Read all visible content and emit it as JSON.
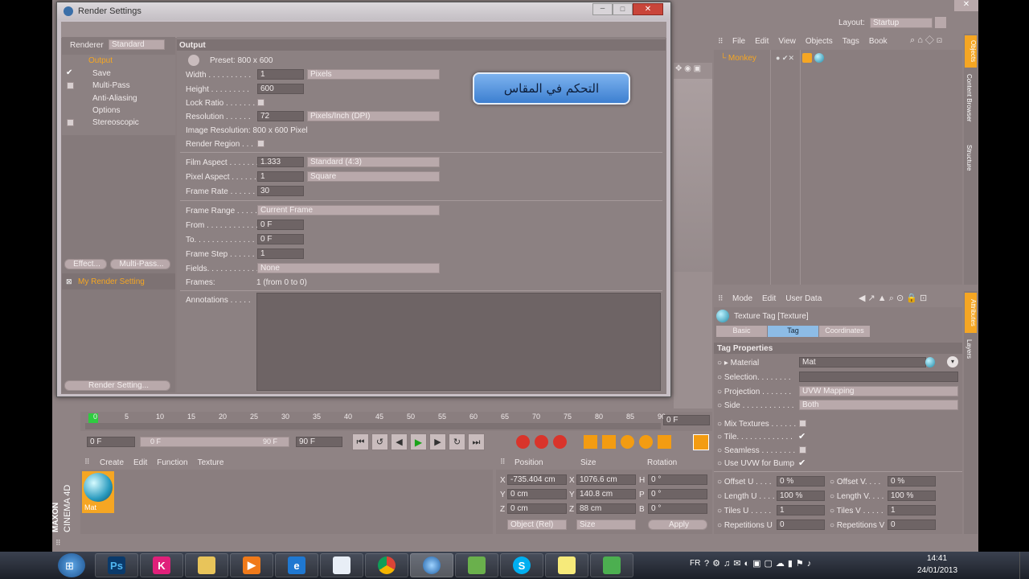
{
  "window": {
    "title": "Render Settings"
  },
  "renderer": {
    "label": "Renderer",
    "value": "Standard"
  },
  "nav": {
    "items": [
      {
        "label": "Output",
        "active": true,
        "checked": false
      },
      {
        "label": "Save",
        "active": false,
        "checked": true
      },
      {
        "label": "Multi-Pass",
        "active": false,
        "checked": false
      },
      {
        "label": "Anti-Aliasing",
        "active": false,
        "checked": false
      },
      {
        "label": "Options",
        "active": false,
        "checked": false
      },
      {
        "label": "Stereoscopic",
        "active": false,
        "checked": false
      }
    ],
    "effect_button": "Effect...",
    "multipass_button": "Multi-Pass...",
    "setting_item": "My Render Setting",
    "render_setting_button": "Render Setting..."
  },
  "output": {
    "header": "Output",
    "preset": "Preset: 800 x 600",
    "width": {
      "label": "Width . . . . . . . . . .",
      "value": "1",
      "unit": "Pixels"
    },
    "height": {
      "label": "Height . . . . . . . . .",
      "value": "600"
    },
    "lock_ratio": {
      "label": "Lock Ratio . . . . . . ."
    },
    "resolution": {
      "label": "Resolution . . . . . .",
      "value": "72",
      "unit": "Pixels/Inch (DPI)"
    },
    "image_resolution": "Image Resolution: 800 x 600 Pixel",
    "render_region": {
      "label": "Render Region . . ."
    },
    "film_aspect": {
      "label": "Film Aspect . . . . . . .",
      "value": "1.333",
      "preset": "Standard (4:3)"
    },
    "pixel_aspect": {
      "label": "Pixel Aspect . . . . . .",
      "value": "1",
      "preset": "Square"
    },
    "frame_rate": {
      "label": "Frame Rate . . . . . .",
      "value": "30"
    },
    "frame_range": {
      "label": "Frame Range . . . . .",
      "value": "Current Frame"
    },
    "from": {
      "label": "From . . . . . . . . . . . .",
      "value": "0 F"
    },
    "to": {
      "label": "To. . . . . . . . . . . . . . .",
      "value": "0 F"
    },
    "frame_step": {
      "label": "Frame Step . . . . . .",
      "value": "1"
    },
    "fields": {
      "label": "Fields. . . . . . . . . . . .",
      "value": "None"
    },
    "frames": {
      "label": "Frames:",
      "value": "1 (from 0 to 0)"
    },
    "annotations": {
      "label": "Annotations . . . . ."
    }
  },
  "caption": "التحكم في المقاس",
  "layout": {
    "label": "Layout:",
    "value": "Startup"
  },
  "object_manager": {
    "menu": [
      "File",
      "Edit",
      "View",
      "Objects",
      "Tags",
      "Book"
    ],
    "objects": [
      {
        "name": "Monkey"
      }
    ]
  },
  "side_tabs": [
    "Objects",
    "Content Browser",
    "Structure"
  ],
  "side_tabs_attr": [
    "Attributes",
    "Layers"
  ],
  "attributes": {
    "menu": [
      "Mode",
      "Edit",
      "User Data"
    ],
    "title": "Texture Tag [Texture]",
    "tabs": [
      "Basic",
      "Tag",
      "Coordinates"
    ],
    "section": "Tag Properties",
    "material": {
      "label": "Material",
      "value": "Mat"
    },
    "selection": {
      "label": "Selection. . . . . . . ."
    },
    "projection": {
      "label": "Projection . . . . . . .",
      "value": "UVW Mapping"
    },
    "side": {
      "label": "Side . . . . . . . . . . . .",
      "value": "Both"
    },
    "mix_textures": {
      "label": "Mix Textures . . . . . ."
    },
    "tile": {
      "label": "Tile. . . . . . . . . . . . ."
    },
    "seamless": {
      "label": "Seamless . . . . . . . ."
    },
    "use_uvw_bump": {
      "label": "Use UVW for Bump"
    },
    "offset_u": {
      "label": "Offset U . . . .",
      "value": "0 %"
    },
    "offset_v": {
      "label": "Offset V. . . .",
      "value": "0 %"
    },
    "length_u": {
      "label": "Length U . . . .",
      "value": "100 %"
    },
    "length_v": {
      "label": "Length V. . . .",
      "value": "100 %"
    },
    "tiles_u": {
      "label": "Tiles U . . . . .",
      "value": "1"
    },
    "tiles_v": {
      "label": "Tiles V . . . . .",
      "value": "1"
    },
    "repetitions_u": {
      "label": "Repetitions U",
      "value": "0"
    },
    "repetitions_v": {
      "label": "Repetitions V",
      "value": "0"
    }
  },
  "timeline": {
    "ticks": [
      "0",
      "5",
      "10",
      "15",
      "20",
      "25",
      "30",
      "35",
      "40",
      "45",
      "50",
      "55",
      "60",
      "65",
      "70",
      "75",
      "80",
      "85",
      "90"
    ],
    "current": "0 F",
    "start": "0 F",
    "range_start": "0 F",
    "range_end": "90 F",
    "end": "90 F"
  },
  "material_manager": {
    "menu": [
      "Create",
      "Edit",
      "Function",
      "Texture"
    ],
    "material": "Mat"
  },
  "coordinates": {
    "headers": [
      "Position",
      "Size",
      "Rotation"
    ],
    "rows": [
      {
        "axis": "X",
        "pos": "-735.404 cm",
        "saxis": "X",
        "size": "1076.6 cm",
        "raxis": "H",
        "rot": "0 °"
      },
      {
        "axis": "Y",
        "pos": "0 cm",
        "saxis": "Y",
        "size": "140.8 cm",
        "raxis": "P",
        "rot": "0 °"
      },
      {
        "axis": "Z",
        "pos": "0 cm",
        "saxis": "Z",
        "size": "88 cm",
        "raxis": "B",
        "rot": "0 °"
      }
    ],
    "mode": "Object (Rel)",
    "size_mode": "Size",
    "apply": "Apply"
  },
  "branding": {
    "maxon": "MAXON",
    "product": "CINEMA 4D"
  },
  "taskbar": {
    "lang": "FR",
    "time": "14:41",
    "date": "24/01/2013"
  }
}
